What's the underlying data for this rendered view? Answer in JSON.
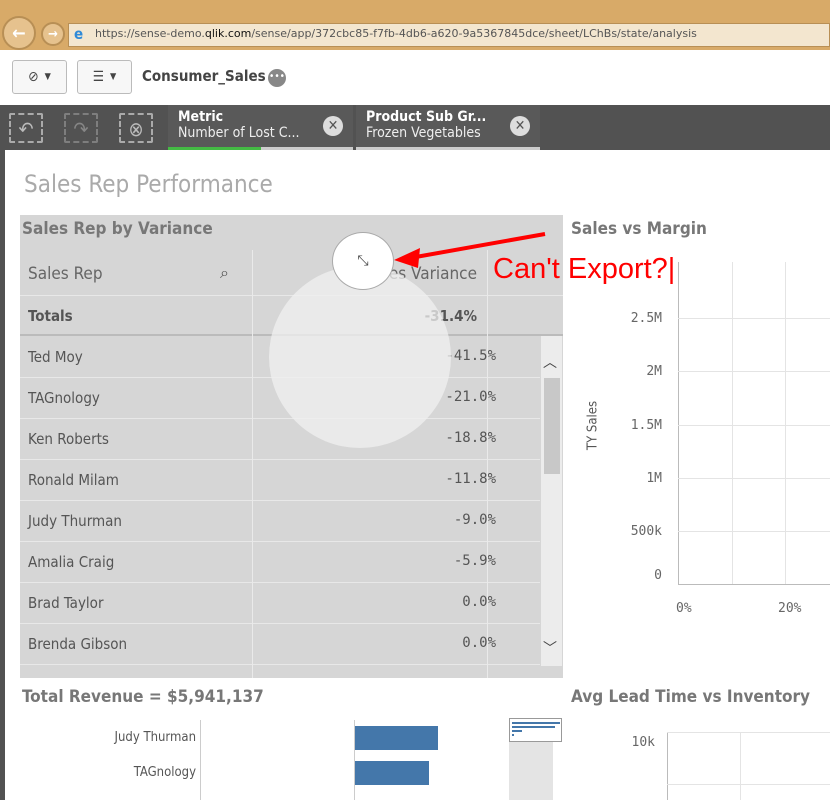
{
  "browser": {
    "url_prefix": "https://sense-demo.",
    "url_domain": "qlik.com",
    "url_path": "/sense/app/372cbc85-f7fb-4db6-a620-9a5367845dce/sheet/LChBs/state/analysis"
  },
  "toolbar": {
    "app_title": "Consumer_Sales"
  },
  "selections": [
    {
      "title": "Metric",
      "value": "Number of Lost C...",
      "progress": 0.5,
      "accent": "#44bb44"
    },
    {
      "title": "Product Sub Gr...",
      "value": "Frozen Vegetables"
    }
  ],
  "sheet": {
    "title": "Sales Rep Performance"
  },
  "table": {
    "title": "Sales Rep by Variance",
    "col1": "Sales Rep",
    "col2": "Sales Variance",
    "totals_label": "Totals",
    "totals_value": "-31.4%",
    "rows": [
      {
        "name": "Ted Moy",
        "value": "-41.5%"
      },
      {
        "name": "TAGnology",
        "value": "-21.0%"
      },
      {
        "name": "Ken Roberts",
        "value": "-18.8%"
      },
      {
        "name": "Ronald Milam",
        "value": "-11.8%"
      },
      {
        "name": "Judy Thurman",
        "value": "-9.0%"
      },
      {
        "name": "Amalia Craig",
        "value": "-5.9%"
      },
      {
        "name": "Brad Taylor",
        "value": "0.0%"
      },
      {
        "name": "Brenda Gibson",
        "value": "0.0%"
      }
    ]
  },
  "annotation": "Can't Export?|",
  "scatter": {
    "title": "Sales vs Margin",
    "ylabel": "TY Sales",
    "yticks": [
      "2.5M",
      "2M",
      "1.5M",
      "1M",
      "500k",
      "0"
    ],
    "xticks": [
      "0%",
      "20%"
    ]
  },
  "revenue": {
    "title": "Total Revenue = $5,941,137",
    "bars": [
      {
        "label": "Judy Thurman"
      },
      {
        "label": "TAGnology"
      }
    ]
  },
  "leadtime": {
    "title": "Avg Lead Time vs Inventory",
    "yticks": [
      "10k"
    ]
  }
}
